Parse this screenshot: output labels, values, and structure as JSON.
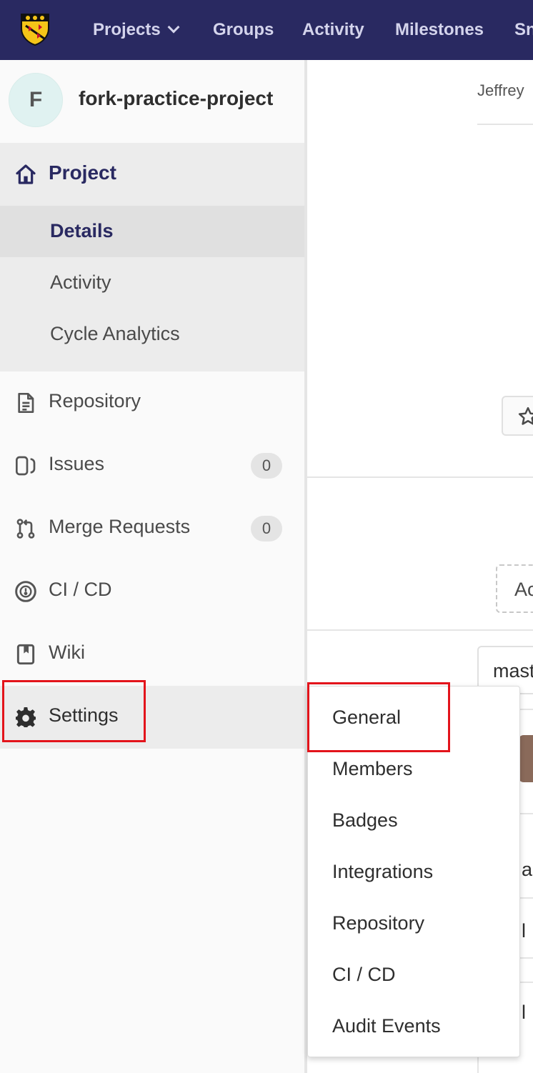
{
  "navbar": {
    "items": [
      {
        "label": "Projects",
        "has_chevron": true
      },
      {
        "label": "Groups"
      },
      {
        "label": "Activity"
      },
      {
        "label": "Milestones"
      },
      {
        "label": "Sn"
      }
    ],
    "background": "#292961"
  },
  "sidebar": {
    "project": {
      "avatar_letter": "F",
      "name": "fork-practice-project"
    },
    "project_section": {
      "label": "Project",
      "items": [
        {
          "label": "Details",
          "active": true
        },
        {
          "label": "Activity"
        },
        {
          "label": "Cycle Analytics"
        }
      ]
    },
    "items": [
      {
        "label": "Repository",
        "icon": "file-text-icon"
      },
      {
        "label": "Issues",
        "icon": "issues-icon",
        "count": "0"
      },
      {
        "label": "Merge Requests",
        "icon": "merge-request-icon",
        "count": "0"
      },
      {
        "label": "CI / CD",
        "icon": "rocket-icon"
      },
      {
        "label": "Wiki",
        "icon": "book-icon"
      },
      {
        "label": "Settings",
        "icon": "gear-icon",
        "highlighted": true
      }
    ]
  },
  "main": {
    "author_text": "Jeffrey",
    "add_button_fragment": "Ac",
    "branch_fragment": "mast",
    "row_fragments": [
      "an",
      "l",
      "l"
    ]
  },
  "settings_dropdown": {
    "items": [
      {
        "label": "General"
      },
      {
        "label": "Members"
      },
      {
        "label": "Badges"
      },
      {
        "label": "Integrations"
      },
      {
        "label": "Repository"
      },
      {
        "label": "CI / CD"
      },
      {
        "label": "Audit Events"
      }
    ]
  },
  "annotation_color": "#e3141b"
}
